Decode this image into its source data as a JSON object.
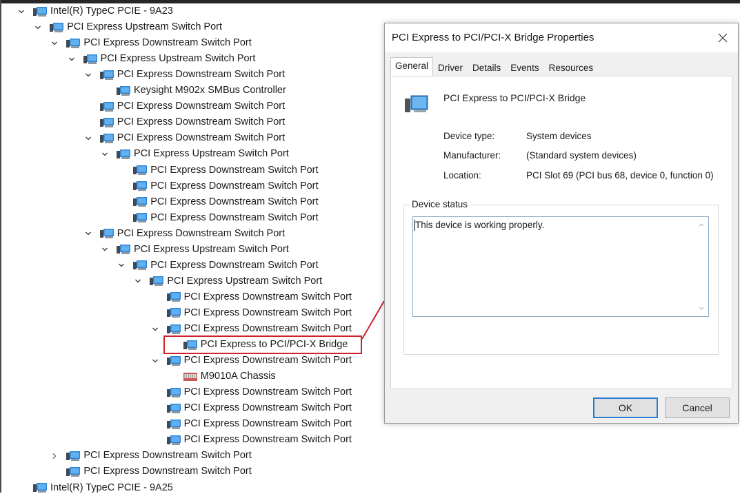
{
  "tree": {
    "nodes": [
      {
        "label": "Intel(R) TypeC PCIE - 9A23",
        "indent": 0,
        "chevron": "expanded"
      },
      {
        "label": "PCI Express Upstream Switch Port",
        "indent": 1,
        "chevron": "expanded"
      },
      {
        "label": "PCI Express Downstream Switch Port",
        "indent": 2,
        "chevron": "expanded"
      },
      {
        "label": "PCI Express Upstream Switch Port",
        "indent": 3,
        "chevron": "expanded"
      },
      {
        "label": "PCI Express Downstream Switch Port",
        "indent": 4,
        "chevron": "expanded"
      },
      {
        "label": "Keysight M902x SMBus Controller",
        "indent": 5,
        "chevron": "none"
      },
      {
        "label": "PCI Express Downstream Switch Port",
        "indent": 4,
        "chevron": "none"
      },
      {
        "label": "PCI Express Downstream Switch Port",
        "indent": 4,
        "chevron": "none"
      },
      {
        "label": "PCI Express Downstream Switch Port",
        "indent": 4,
        "chevron": "expanded"
      },
      {
        "label": "PCI Express Upstream Switch Port",
        "indent": 5,
        "chevron": "expanded"
      },
      {
        "label": "PCI Express Downstream Switch Port",
        "indent": 6,
        "chevron": "none"
      },
      {
        "label": "PCI Express Downstream Switch Port",
        "indent": 6,
        "chevron": "none"
      },
      {
        "label": "PCI Express Downstream Switch Port",
        "indent": 6,
        "chevron": "none"
      },
      {
        "label": "PCI Express Downstream Switch Port",
        "indent": 6,
        "chevron": "none"
      },
      {
        "label": "PCI Express Downstream Switch Port",
        "indent": 4,
        "chevron": "expanded"
      },
      {
        "label": "PCI Express Upstream Switch Port",
        "indent": 5,
        "chevron": "expanded"
      },
      {
        "label": "PCI Express Downstream Switch Port",
        "indent": 6,
        "chevron": "expanded"
      },
      {
        "label": "PCI Express Upstream Switch Port",
        "indent": 7,
        "chevron": "expanded"
      },
      {
        "label": "PCI Express Downstream Switch Port",
        "indent": 8,
        "chevron": "none"
      },
      {
        "label": "PCI Express Downstream Switch Port",
        "indent": 8,
        "chevron": "none"
      },
      {
        "label": "PCI Express Downstream Switch Port",
        "indent": 8,
        "chevron": "expanded"
      },
      {
        "label": "PCI Express to PCI/PCI-X Bridge",
        "indent": 9,
        "chevron": "none",
        "highlighted": true
      },
      {
        "label": "PCI Express Downstream Switch Port",
        "indent": 8,
        "chevron": "expanded"
      },
      {
        "label": "M9010A Chassis",
        "indent": 9,
        "chevron": "none",
        "icon": "chassis-icon"
      },
      {
        "label": "PCI Express Downstream Switch Port",
        "indent": 8,
        "chevron": "none"
      },
      {
        "label": "PCI Express Downstream Switch Port",
        "indent": 8,
        "chevron": "none"
      },
      {
        "label": "PCI Express Downstream Switch Port",
        "indent": 8,
        "chevron": "none"
      },
      {
        "label": "PCI Express Downstream Switch Port",
        "indent": 8,
        "chevron": "none"
      },
      {
        "label": "PCI Express Downstream Switch Port",
        "indent": 2,
        "chevron": "collapsed"
      },
      {
        "label": "PCI Express Downstream Switch Port",
        "indent": 2,
        "chevron": "none"
      },
      {
        "label": "Intel(R) TypeC PCIE - 9A25",
        "indent": 0,
        "chevron": "none"
      }
    ]
  },
  "dialog": {
    "title": "PCI Express to PCI/PCI-X Bridge Properties",
    "tabs": [
      {
        "label": "General",
        "active": true
      },
      {
        "label": "Driver"
      },
      {
        "label": "Details"
      },
      {
        "label": "Events"
      },
      {
        "label": "Resources"
      }
    ],
    "device_name": "PCI Express to PCI/PCI-X Bridge",
    "properties": [
      {
        "label": "Device type:",
        "value": "System devices"
      },
      {
        "label": "Manufacturer:",
        "value": "(Standard system devices)"
      },
      {
        "label": "Location:",
        "value": "PCI Slot 69 (PCI bus 68, device 0, function 0)"
      }
    ],
    "status_group_label": "Device status",
    "status_text": "This device is working properly.",
    "ok_label": "OK",
    "cancel_label": "Cancel"
  },
  "colors": {
    "highlight": "#d0202a",
    "default_button_border": "#2a7bd4"
  }
}
